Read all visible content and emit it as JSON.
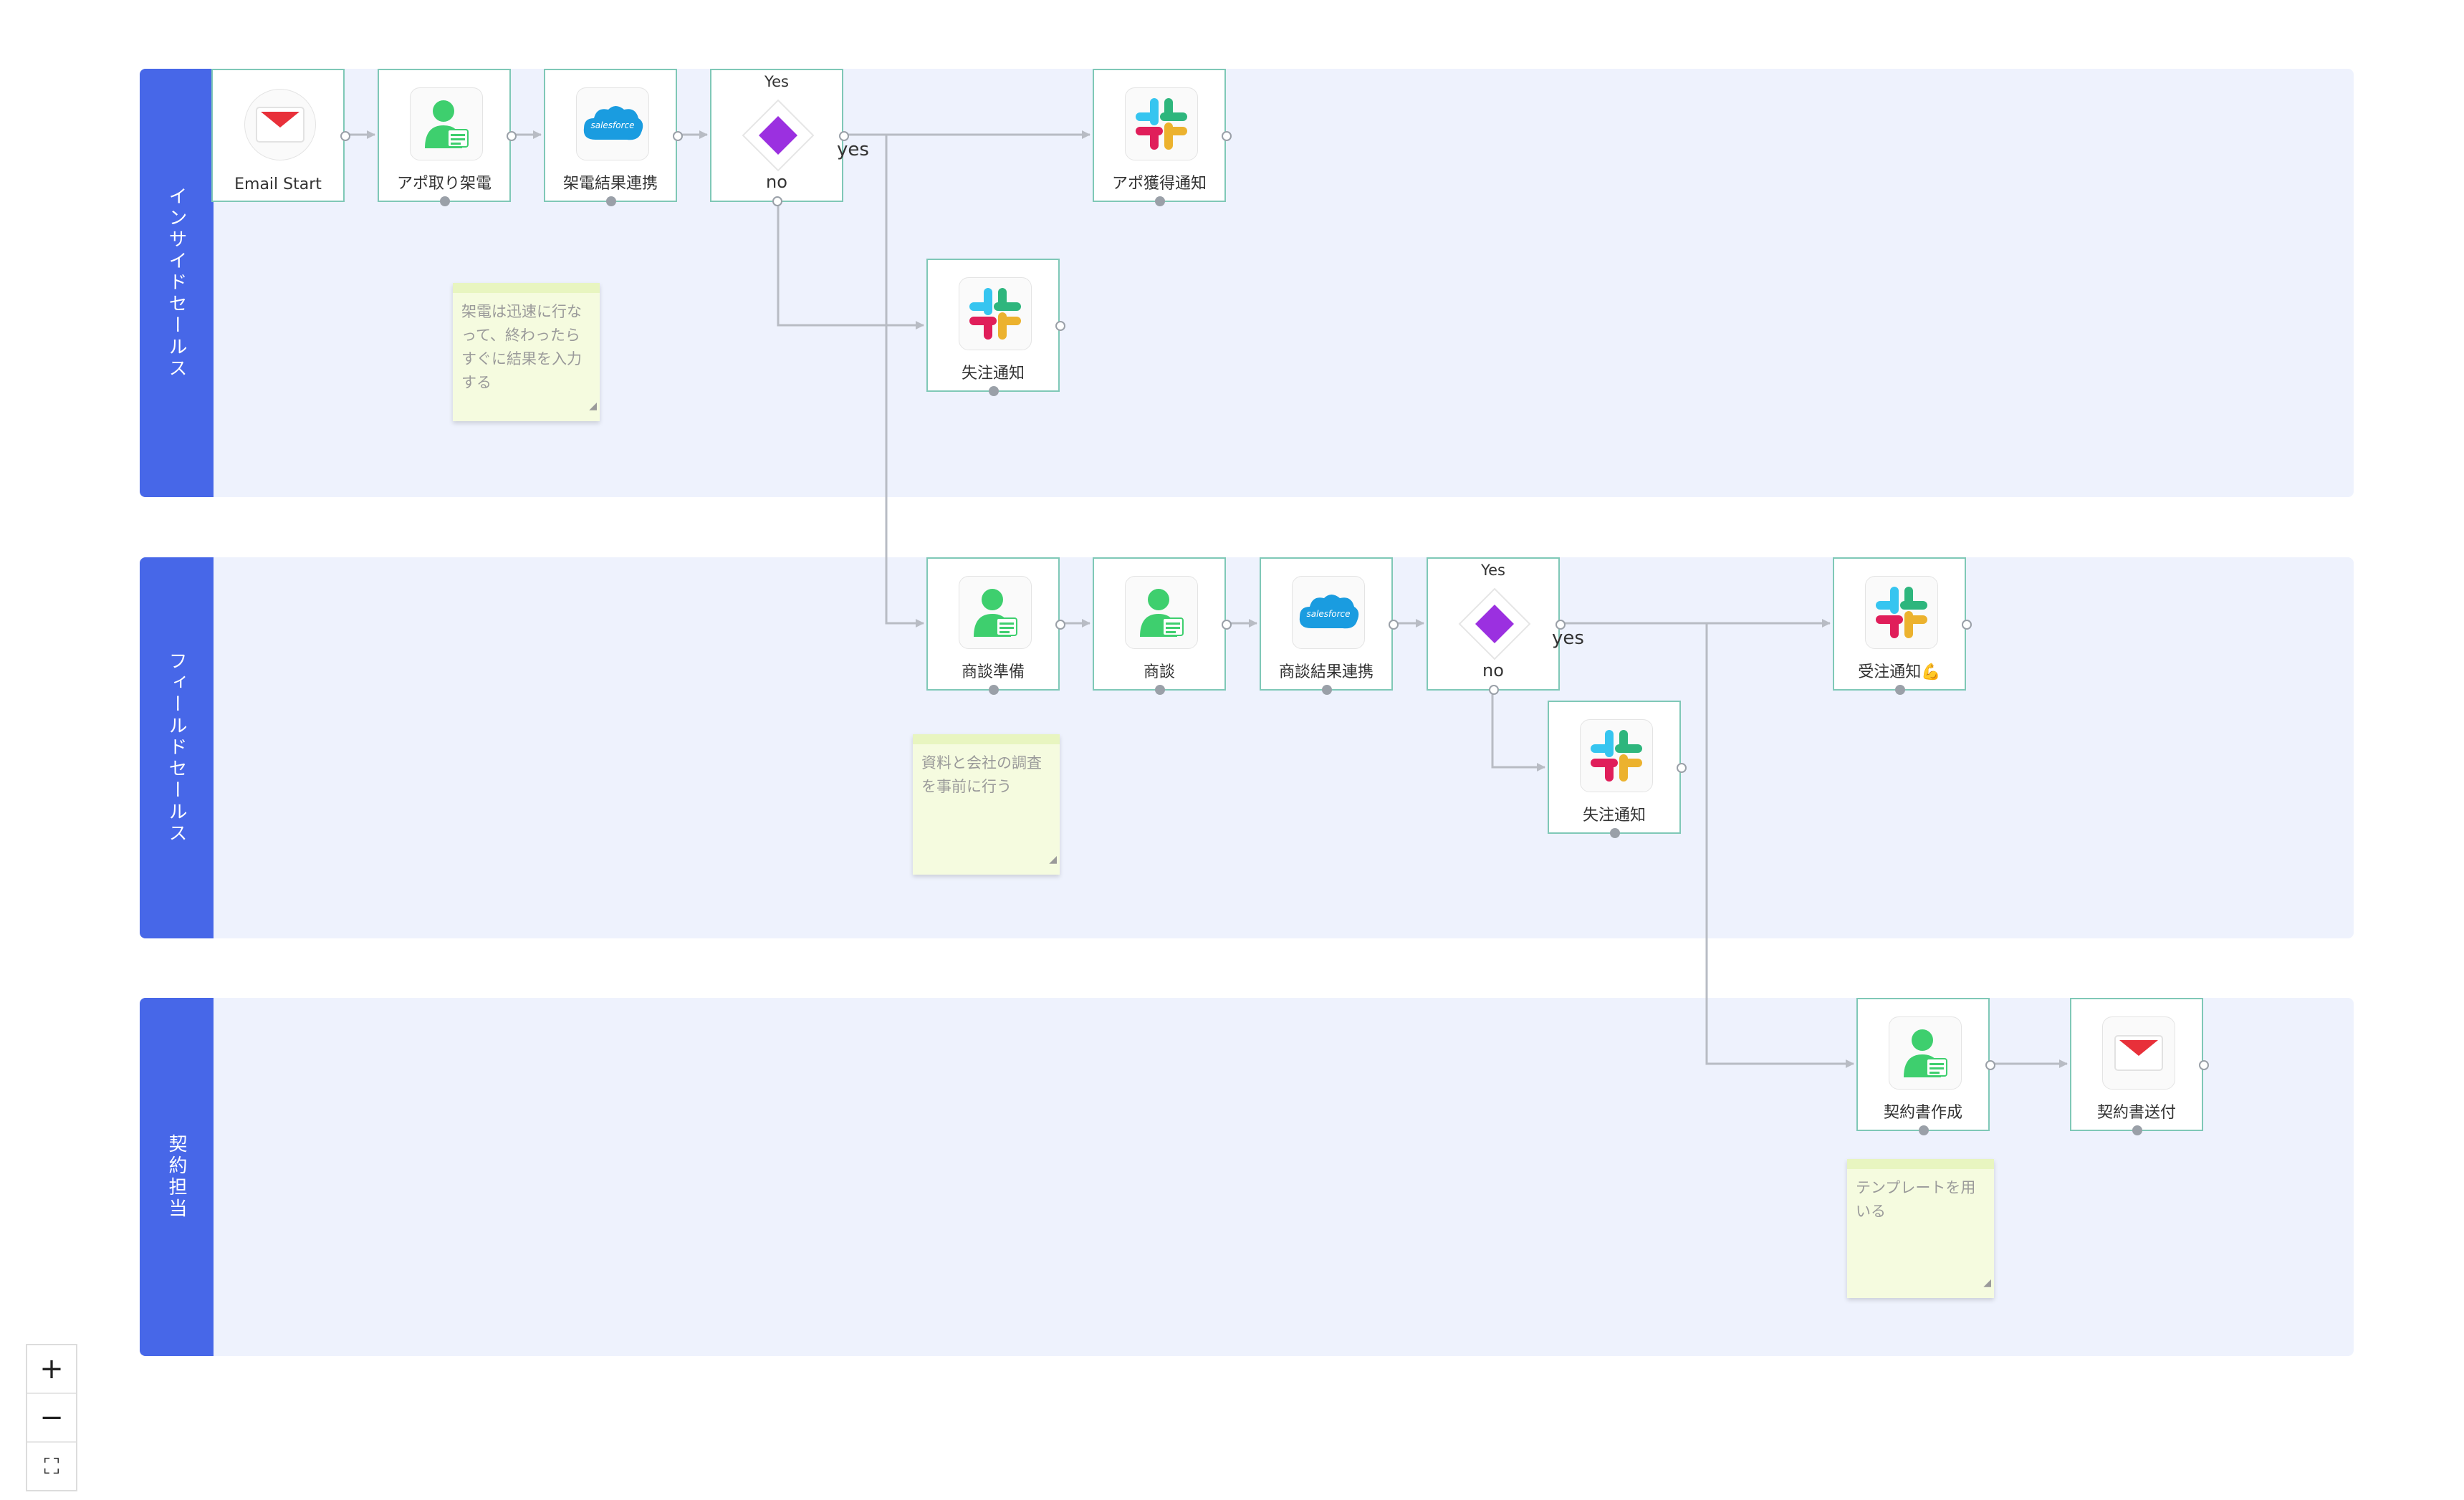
{
  "lanes": [
    {
      "title": "インサイドセールス"
    },
    {
      "title": "フィールドセールス"
    },
    {
      "title": "契約担当"
    }
  ],
  "nodes": {
    "email_start": {
      "label": "Email Start",
      "icon": "email-icon"
    },
    "apo_call": {
      "label": "アポ取り架電",
      "icon": "person-icon"
    },
    "call_result_sync": {
      "label": "架電結果連携",
      "icon": "salesforce-icon"
    },
    "branch1": {
      "top_label": "Yes",
      "bottom_label": "no",
      "icon": "diamond-icon"
    },
    "apo_notify": {
      "label": "アポ獲得通知",
      "icon": "slack-icon"
    },
    "lost_notify_1": {
      "label": "失注通知",
      "icon": "slack-icon"
    },
    "meeting_prep": {
      "label": "商談準備",
      "icon": "person-icon"
    },
    "meeting": {
      "label": "商談",
      "icon": "person-icon"
    },
    "meeting_result_sync": {
      "label": "商談結果連携",
      "icon": "salesforce-icon"
    },
    "branch2": {
      "top_label": "Yes",
      "bottom_label": "no",
      "icon": "diamond-icon"
    },
    "won_notify": {
      "label": "受注通知💪",
      "icon": "slack-icon"
    },
    "lost_notify_2": {
      "label": "失注通知",
      "icon": "slack-icon"
    },
    "contract_create": {
      "label": "契約書作成",
      "icon": "person-icon"
    },
    "contract_send": {
      "label": "契約書送付",
      "icon": "email-icon"
    }
  },
  "branch_labels": {
    "yes1": "yes",
    "yes2": "yes"
  },
  "salesforce_text": "salesforce",
  "notes": [
    {
      "text": "架電は迅速に行なって、終わったらすぐに結果を入力する"
    },
    {
      "text": "資料と会社の調査を事前に行う"
    },
    {
      "text": "テンプレートを用いる"
    }
  ],
  "zoom": {
    "in": "+",
    "out": "−",
    "fit": "⛶"
  },
  "colors": {
    "lane_header": "#4767e8",
    "lane_bg": "#eef2fd",
    "node_border": "#7fc8b7",
    "edge": "#b8bcc4",
    "diamond": "#9b30e0",
    "person": "#3ecf6e",
    "salesforce": "#1a9ce0",
    "email_red": "#e8303a",
    "note_bg": "#f5fbdf"
  }
}
